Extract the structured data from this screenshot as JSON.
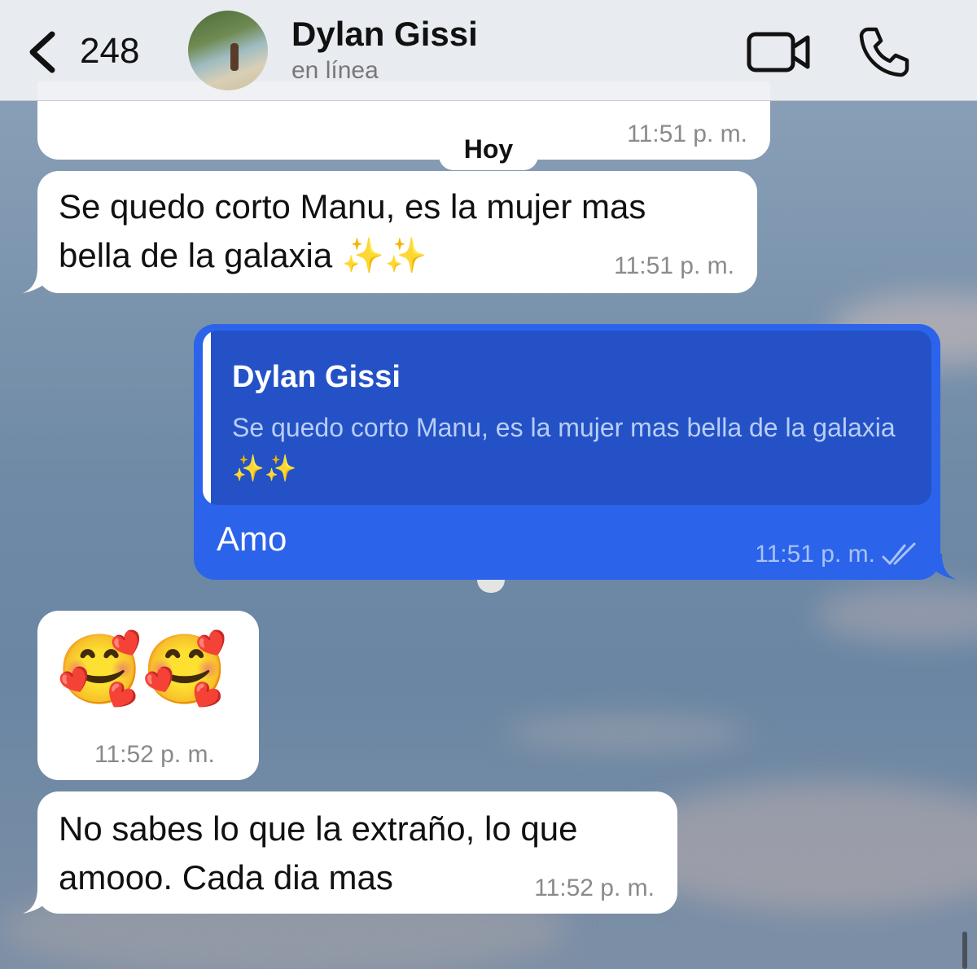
{
  "header": {
    "back_count": "248",
    "contact_name": "Dylan Gissi",
    "contact_status": "en línea",
    "icons": [
      "chevron-left-icon",
      "video-call-icon",
      "phone-icon"
    ]
  },
  "date_separator": "Hoy",
  "messages": [
    {
      "direction": "in",
      "text": "",
      "time": "11:51 p. m."
    },
    {
      "direction": "in",
      "text_line1": "Se quedo corto Manu, es la mujer mas",
      "text_line2": "bella de la galaxia ✨✨",
      "time": "11:51 p. m."
    },
    {
      "direction": "out",
      "reply_to_name": "Dylan Gissi",
      "reply_to_text": "Se quedo corto Manu, es la mujer mas bella de la galaxia ✨✨",
      "text": "Amo",
      "time": "11:51 p. m.",
      "status": "read-double-check"
    },
    {
      "direction": "in",
      "emoji": "🥰🥰",
      "time": "11:52 p. m."
    },
    {
      "direction": "in",
      "text_line1": "No sabes lo que la extraño, lo que",
      "text_line2": "amooo. Cada dia mas",
      "time": "11:52 p. m."
    }
  ],
  "colors": {
    "outgoing_bubble": "#2b63ea",
    "quote_bg": "#2452c6",
    "incoming_bubble": "#ffffff",
    "header_bg": "#eef0f3"
  }
}
